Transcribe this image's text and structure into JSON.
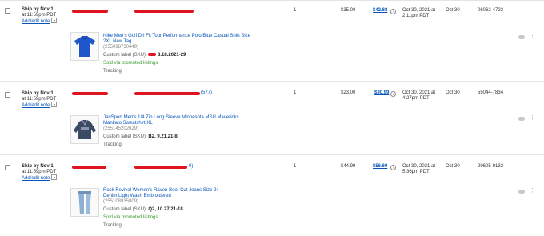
{
  "orders": [
    {
      "ship_by": "Ship by Nov 1",
      "ship_time": "at 11:59pm PDT",
      "note_link": "Add/edit note",
      "buyer_suffix": "",
      "qty": "1",
      "sold_price": "$35.00",
      "total": "$42.68",
      "date_sold": "Oct 30, 2021 at",
      "date_sold_time": "2:11pm PDT",
      "date_paid": "Oct 30",
      "order_num": "06062-4723",
      "item_title": "Nike Men's Golf Dri Fit Tour Performance Polo Blue Casual Shirt Size 2XL New Tag",
      "item_id": "(255098730449)",
      "custom_label_prefix": "Custom label (SKU):",
      "custom_label_value": "8.18.2021-29",
      "promoted": "Sold via promoted listings",
      "tracking": "Tracking",
      "thumb": "blue-polo-shirt"
    },
    {
      "ship_by": "Ship by Nov 1",
      "ship_time": "at 11:59pm PDT",
      "note_link": "Add/edit note",
      "buyer_suffix": "(577)",
      "qty": "1",
      "sold_price": "$23.00",
      "total": "$30.99",
      "date_sold": "Oct 30, 2021 at",
      "date_sold_time": "4:27pm PDT",
      "date_paid": "Oct 30",
      "order_num": "55044-7834",
      "item_title": "JanSport Men's 1/4 Zip Long Sleeve Minnesota MSU Mavericks Mankato Sweatshirt XL",
      "item_id": "(255145202629)",
      "custom_label_prefix": "Custom label (SKU):",
      "custom_label_value": "B2, 9.21.21-8",
      "promoted": "",
      "tracking": "Tracking",
      "thumb": "navy-sweatshirt"
    },
    {
      "ship_by": "Ship by Nov 1",
      "ship_time": "at 11:59pm PDT",
      "note_link": "Add/edit note",
      "buyer_suffix": "0)",
      "qty": "1",
      "sold_price": "$44.99",
      "total": "$56.69",
      "date_sold": "Oct 30, 2021 at",
      "date_sold_time": "5:36pm PDT",
      "date_paid": "Oct 30",
      "order_num": "29605-9132",
      "item_title": "Rock Revival Women's Raven Boot Cut Jeans Size 24 Denim Light Wash Embroidered",
      "item_id": "(255108935809)",
      "custom_label_prefix": "Custom label (SKU):",
      "custom_label_value": "Q2, 10.27.21-18",
      "promoted": "Sold via promoted listings",
      "tracking": "Tracking",
      "thumb": "light-wash-jeans"
    }
  ],
  "colors": {
    "link": "#0654ba",
    "promoted_green": "#3a9b2f",
    "redaction": "#e0141e"
  }
}
